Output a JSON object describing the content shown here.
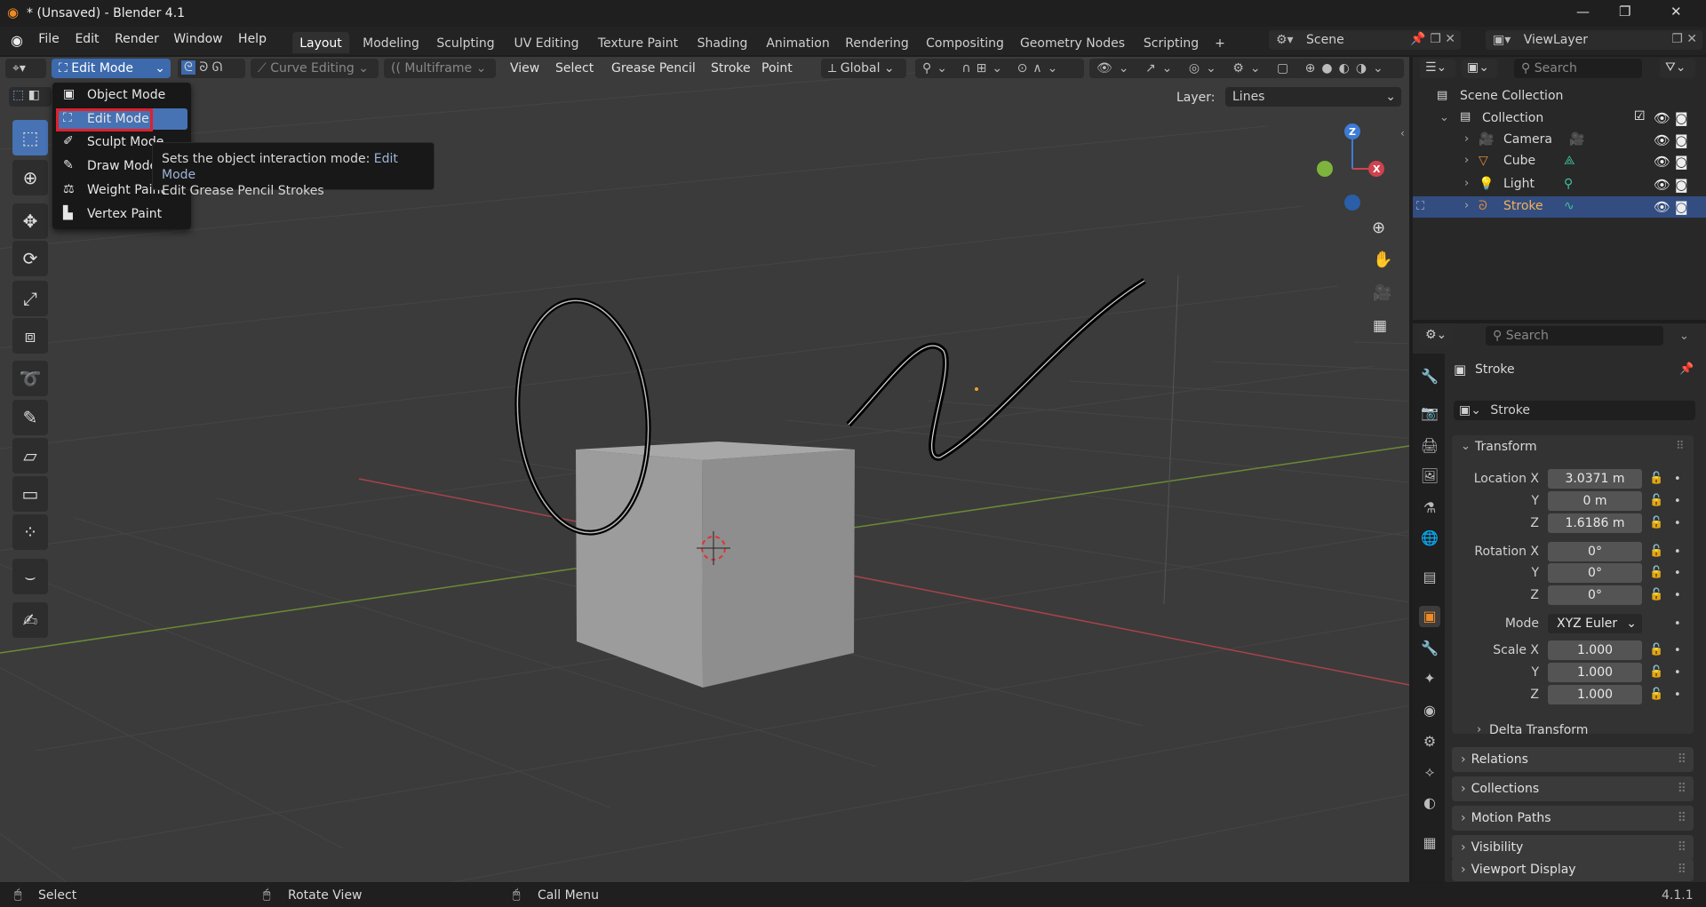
{
  "window": {
    "title": "* (Unsaved) - Blender 4.1",
    "controls": [
      "—",
      "❐",
      "✕"
    ]
  },
  "menus": [
    "File",
    "Edit",
    "Render",
    "Window",
    "Help"
  ],
  "workspaces": [
    "Layout",
    "Modeling",
    "Sculpting",
    "UV Editing",
    "Texture Paint",
    "Shading",
    "Animation",
    "Rendering",
    "Compositing",
    "Geometry Nodes",
    "Scripting",
    "+"
  ],
  "active_workspace": "Layout",
  "scene": {
    "name": "Scene",
    "view_layer": "ViewLayer"
  },
  "viewport_header": {
    "mode": "Edit Mode",
    "curve_editing": "Curve Editing",
    "multiframe": "Multiframe",
    "menus": [
      "View",
      "Select",
      "Grease Pencil",
      "Stroke",
      "Point"
    ],
    "orientation": "Global",
    "layer_label": "Layer:",
    "layer_value": "Lines"
  },
  "mode_menu": {
    "items": [
      "Object Mode",
      "Edit Mode",
      "Sculpt Mode",
      "Draw Mode",
      "Weight Paint",
      "Vertex Paint"
    ],
    "selected": "Edit Mode"
  },
  "tooltip": {
    "line1_prefix": "Sets the object interaction mode:",
    "line1_value": "Edit Mode",
    "line2": "Edit Grease Pencil Strokes"
  },
  "gizmo": {
    "z": "Z",
    "x": "X"
  },
  "outliner": {
    "search_placeholder": "Search",
    "scene_collection": "Scene Collection",
    "collection": "Collection",
    "objects": [
      "Camera",
      "Cube",
      "Light",
      "Stroke"
    ],
    "selected": "Stroke"
  },
  "properties": {
    "search_placeholder": "Search",
    "object_name": "Stroke",
    "data_name": "Stroke",
    "transform": {
      "title": "Transform",
      "location_label": "Location X",
      "location": [
        "3.0371 m",
        "0 m",
        "1.6186 m"
      ],
      "rotation_label": "Rotation X",
      "rotation": [
        "0°",
        "0°",
        "0°"
      ],
      "mode_label": "Mode",
      "mode": "XYZ Euler",
      "scale_label": "Scale X",
      "scale": [
        "1.000",
        "1.000",
        "1.000"
      ],
      "axis_y": "Y",
      "axis_z": "Z"
    },
    "delta_transform": "Delta Transform",
    "panels": [
      "Relations",
      "Collections",
      "Motion Paths",
      "Visibility",
      "Viewport Display"
    ]
  },
  "statusbar": {
    "select": "Select",
    "rotate": "Rotate View",
    "call_menu": "Call Menu",
    "version": "4.1.1"
  },
  "colors": {
    "accent": "#4772b3",
    "selected_row": "#334d80",
    "x_axis": "#d0424f",
    "y_axis": "#7eb33c",
    "z_axis": "#3d7cd6",
    "active_text": "#f0b25a"
  }
}
